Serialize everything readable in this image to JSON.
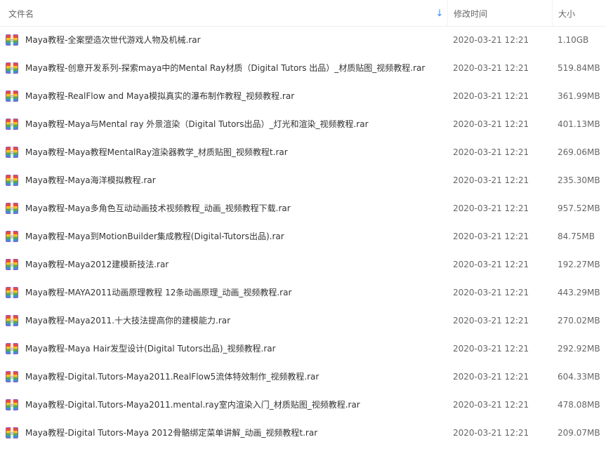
{
  "header": {
    "name_label": "文件名",
    "time_label": "修改时间",
    "size_label": "大小",
    "sort_icon": "sort-down-arrow-icon"
  },
  "colors": {
    "accent": "#3b8cff",
    "icon_red": "#e84d3d",
    "icon_yellow": "#f7c21a",
    "icon_green": "#4caf50",
    "icon_blue": "#3f8fd8",
    "icon_purple": "#8e5bbf"
  },
  "file_icon": "rar-archive-icon",
  "files": [
    {
      "name": "Maya教程-全案塑造次世代游戏人物及机械.rar",
      "time": "2020-03-21 12:21",
      "size": "1.10GB"
    },
    {
      "name": "Maya教程-创意开发系列-探索maya中的Mental Ray材质（Digital Tutors 出品）_材质贴图_视频教程.rar",
      "time": "2020-03-21 12:21",
      "size": "519.84MB"
    },
    {
      "name": "Maya教程-RealFlow and Maya模拟真实的瀑布制作教程_视频教程.rar",
      "time": "2020-03-21 12:21",
      "size": "361.99MB"
    },
    {
      "name": "Maya教程-Maya与Mental ray 外景渲染（Digital Tutors出品）_灯光和渲染_视频教程.rar",
      "time": "2020-03-21 12:21",
      "size": "401.13MB"
    },
    {
      "name": "Maya教程-Maya教程MentalRay渲染器教学_材质贴图_视频教程t.rar",
      "time": "2020-03-21 12:21",
      "size": "269.06MB"
    },
    {
      "name": "Maya教程-Maya海洋模拟教程.rar",
      "time": "2020-03-21 12:21",
      "size": "235.30MB"
    },
    {
      "name": "Maya教程-Maya多角色互动动画技术视频教程_动画_视频教程下载.rar",
      "time": "2020-03-21 12:21",
      "size": "957.52MB"
    },
    {
      "name": "Maya教程-Maya到MotionBuilder集成教程(Digital-Tutors出品).rar",
      "time": "2020-03-21 12:21",
      "size": "84.75MB"
    },
    {
      "name": "Maya教程-Maya2012建模新技法.rar",
      "time": "2020-03-21 12:21",
      "size": "192.27MB"
    },
    {
      "name": "Maya教程-MAYA2011动画原理教程 12条动画原理_动画_视频教程.rar",
      "time": "2020-03-21 12:21",
      "size": "443.29MB"
    },
    {
      "name": "Maya教程-Maya2011.十大技法提高你的建模能力.rar",
      "time": "2020-03-21 12:21",
      "size": "270.02MB"
    },
    {
      "name": "Maya教程-Maya Hair发型设计(Digital Tutors出品)_视频教程.rar",
      "time": "2020-03-21 12:21",
      "size": "292.92MB"
    },
    {
      "name": "Maya教程-Digital.Tutors-Maya2011.RealFlow5流体特效制作_视频教程.rar",
      "time": "2020-03-21 12:21",
      "size": "604.33MB"
    },
    {
      "name": "Maya教程-Digital.Tutors-Maya2011.mental.ray室内渲染入门_材质贴图_视频教程.rar",
      "time": "2020-03-21 12:21",
      "size": "478.08MB"
    },
    {
      "name": "Maya教程-Digital Tutors-Maya 2012骨骼绑定菜单讲解_动画_视频教程t.rar",
      "time": "2020-03-21 12:21",
      "size": "209.07MB"
    }
  ]
}
